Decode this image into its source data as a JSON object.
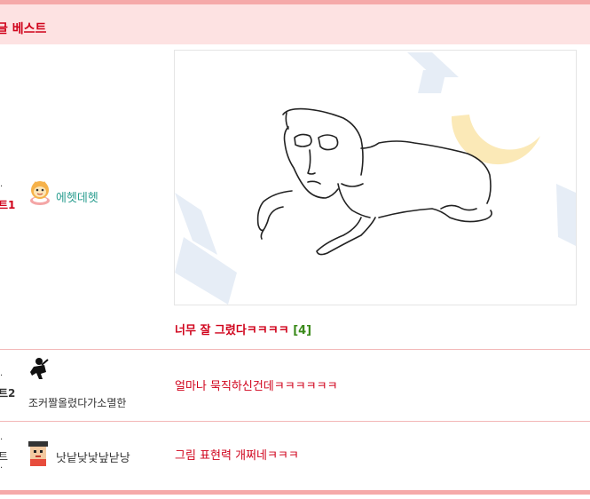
{
  "header": {
    "title": "글 베스트"
  },
  "rows": [
    {
      "rank": "트1",
      "nickname": "에헷데헷",
      "nickname_color": "#2a9d8f",
      "avatar_icon": "character-emoji-icon",
      "title": "너무 잘 그렸다ㅋㅋㅋㅋ",
      "comment_count": "[4]"
    },
    {
      "rank": "트2",
      "nickname": "조커짤올렸다가소멸한",
      "nickname_color": "#333333",
      "avatar_icon": "silhouette-icon",
      "title": "얼마나 묵직하신건데ㅋㅋㅋㅋㅋㅋ"
    },
    {
      "rank": "트",
      "nickname": "낫낱낮낯낲낟낭",
      "nickname_color": "#333333",
      "avatar_icon": "pixel-avatar-icon",
      "title": "그림 표현력 개쩌네ㅋㅋㅋ"
    }
  ],
  "colors": {
    "accent": "#d0021b",
    "border": "#f5a9a9",
    "header_bg": "#fde2e2"
  }
}
